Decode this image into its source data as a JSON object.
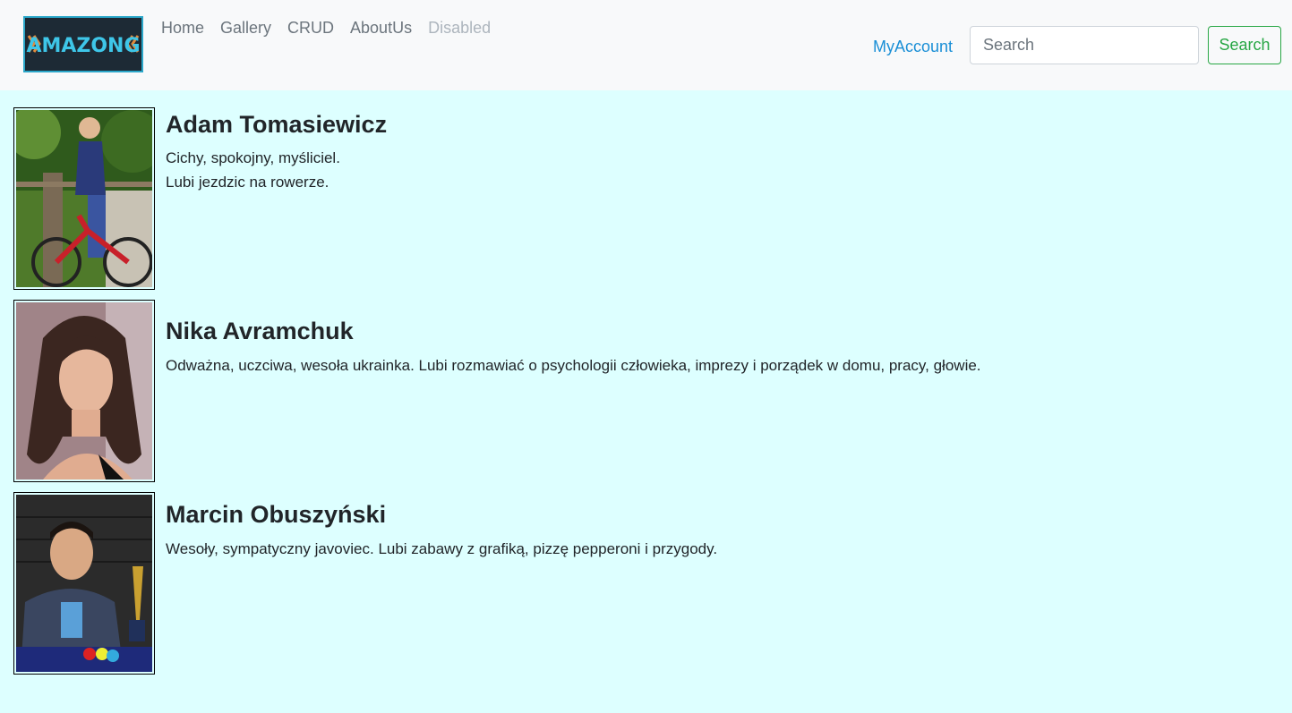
{
  "brand": {
    "logo_text": "AMAZONG"
  },
  "nav": {
    "items": [
      {
        "label": "Home"
      },
      {
        "label": "Gallery"
      },
      {
        "label": "CRUD"
      },
      {
        "label": "AboutUs"
      },
      {
        "label": "Disabled"
      }
    ],
    "account_label": "MyAccount",
    "search_placeholder": "Search",
    "search_button_label": "Search"
  },
  "people": [
    {
      "name": "Adam Tomasiewicz",
      "lines": [
        "Cichy, spokojny, myśliciel.",
        "Lubi jezdzic na rowerze."
      ]
    },
    {
      "name": "Nika Avramchuk",
      "lines": [
        "Odważna, uczciwa, wesoła ukrainka. Lubi rozmawiać o psychologii człowieka, imprezy i porządek w domu, pracy, głowie."
      ]
    },
    {
      "name": "Marcin Obuszyński",
      "lines": [
        "Wesoły, sympatyczny javoviec. Lubi zabawy z grafiką, pizzę pepperoni i przygody."
      ]
    }
  ],
  "colors": {
    "page_background": "#ddffff",
    "navbar_background": "#f8f9fa",
    "account_link": "#1a8fd6",
    "search_button": "#28a745"
  }
}
